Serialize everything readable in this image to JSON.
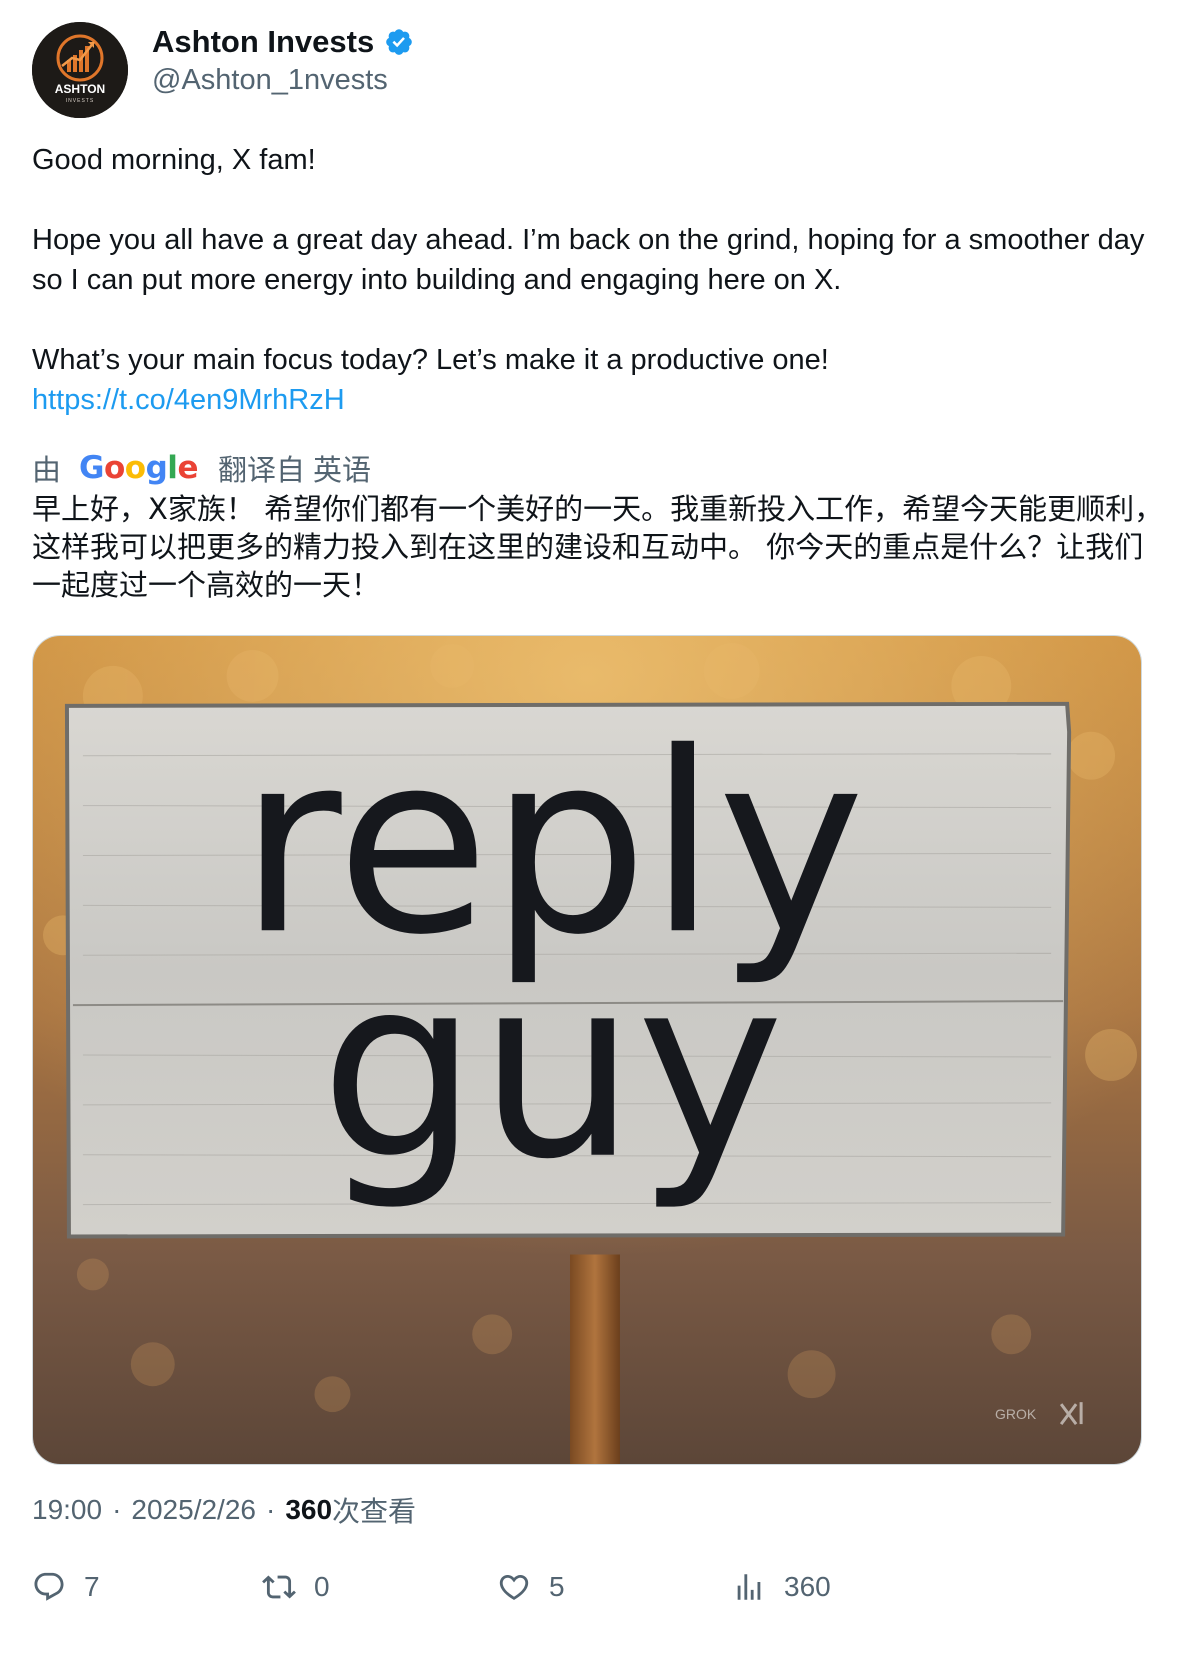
{
  "author": {
    "display_name": "Ashton Invests",
    "handle": "@Ashton_1nvests",
    "verified": true,
    "avatar_text": "ASHTON",
    "avatar_subtext": "INVESTS"
  },
  "tweet": {
    "line1": "Good morning, X fam!",
    "line2": "Hope you all have a great day ahead. I’m back on the grind, hoping for a smoother day so I can put more energy into building and engaging here on X.",
    "line3": "What’s your main focus today? Let’s make it a productive one!",
    "link": "https://t.co/4en9MrhRzH"
  },
  "translation": {
    "by_label": "由",
    "provider": "Google",
    "from_label": "翻译自 英语",
    "text": "早上好，X家族！ 希望你们都有一个美好的一天。我重新投入工作，希望今天能更顺利，这样我可以把更多的精力投入到在这里的建设和互动中。 你今天的重点是什么？让我们一起度过一个高效的一天！"
  },
  "media": {
    "sign_line1": "reply",
    "sign_line2": "guy",
    "watermark": "GROK"
  },
  "meta": {
    "time": "19:00",
    "date": "2025/2/26",
    "views": "360",
    "views_label": "次查看"
  },
  "actions": {
    "replies": "7",
    "reposts": "0",
    "likes": "5",
    "views": "360"
  },
  "colors": {
    "link": "#1d9bf0",
    "secondary_text": "#536471",
    "verified_badge": "#1d9bf0"
  }
}
